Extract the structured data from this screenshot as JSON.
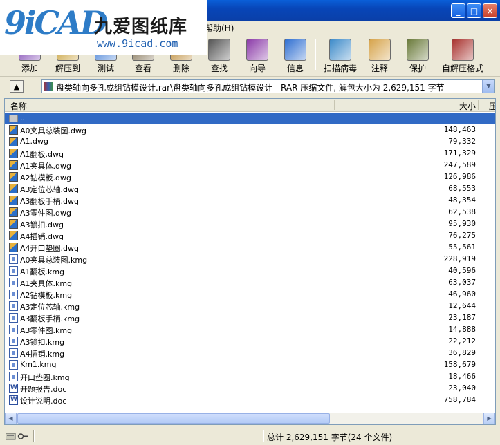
{
  "watermark": {
    "mark": "9iCAD",
    "name_cn": "九爱图纸库",
    "url": "www.9icad.com"
  },
  "menu": {
    "help": "帮助(H)"
  },
  "toolbar": [
    {
      "id": "add",
      "label": "添加",
      "icon": "add-archive-icon",
      "color": "#7a3fb0"
    },
    {
      "id": "extract",
      "label": "解压到",
      "icon": "extract-icon",
      "color": "#c49a2c"
    },
    {
      "id": "test",
      "label": "测试",
      "icon": "test-icon",
      "color": "#3c7ad4"
    },
    {
      "id": "view",
      "label": "查看",
      "icon": "view-icon",
      "color": "#7b6a4a"
    },
    {
      "id": "delete",
      "label": "删除",
      "icon": "delete-icon",
      "color": "#b7832a"
    },
    {
      "id": "find",
      "label": "查找",
      "icon": "find-icon",
      "color": "#555555"
    },
    {
      "id": "wizard",
      "label": "向导",
      "icon": "wizard-icon",
      "color": "#8b3aa8"
    },
    {
      "id": "info",
      "label": "信息",
      "icon": "info-icon",
      "color": "#2f6fd1"
    },
    {
      "id": "virus",
      "label": "扫描病毒",
      "icon": "scan-virus-icon",
      "color": "#3c8ac9"
    },
    {
      "id": "comment",
      "label": "注释",
      "icon": "comment-icon",
      "color": "#d6a34a"
    },
    {
      "id": "protect",
      "label": "保护",
      "icon": "protect-icon",
      "color": "#6a7a3a"
    },
    {
      "id": "sfx",
      "label": "自解压格式",
      "icon": "sfx-icon",
      "color": "#a8322e"
    }
  ],
  "address": {
    "text": "盘类轴向多孔成组钻模设计.rar\\盘类轴向多孔成组钻模设计 - RAR 压缩文件, 解包大小为 2,629,151 字节"
  },
  "columns": {
    "name": "名称",
    "size": "大小",
    "packed": "压"
  },
  "files": [
    {
      "name": "..",
      "size": "",
      "type": "folder"
    },
    {
      "name": "A0夹具总装图.dwg",
      "size": "148,463",
      "type": "dwg"
    },
    {
      "name": "A1.dwg",
      "size": "79,332",
      "type": "dwg"
    },
    {
      "name": "A1翻板.dwg",
      "size": "171,329",
      "type": "dwg"
    },
    {
      "name": "A1夹具体.dwg",
      "size": "247,589",
      "type": "dwg"
    },
    {
      "name": "A2钻模板.dwg",
      "size": "126,986",
      "type": "dwg"
    },
    {
      "name": "A3定位芯轴.dwg",
      "size": "68,553",
      "type": "dwg"
    },
    {
      "name": "A3翻板手柄.dwg",
      "size": "48,354",
      "type": "dwg"
    },
    {
      "name": "A3零件图.dwg",
      "size": "62,538",
      "type": "dwg"
    },
    {
      "name": "A3锁扣.dwg",
      "size": "95,930",
      "type": "dwg"
    },
    {
      "name": "A4插销.dwg",
      "size": "76,275",
      "type": "dwg"
    },
    {
      "name": "A4开口垫圈.dwg",
      "size": "55,561",
      "type": "dwg"
    },
    {
      "name": "A0夹具总装图.kmg",
      "size": "228,919",
      "type": "kmg"
    },
    {
      "name": "A1翻板.kmg",
      "size": "40,596",
      "type": "kmg"
    },
    {
      "name": "A1夹具体.kmg",
      "size": "63,037",
      "type": "kmg"
    },
    {
      "name": "A2钻模板.kmg",
      "size": "46,960",
      "type": "kmg"
    },
    {
      "name": "A3定位芯轴.kmg",
      "size": "12,644",
      "type": "kmg"
    },
    {
      "name": "A3翻板手柄.kmg",
      "size": "23,187",
      "type": "kmg"
    },
    {
      "name": "A3零件图.kmg",
      "size": "14,888",
      "type": "kmg"
    },
    {
      "name": "A3锁扣.kmg",
      "size": "22,212",
      "type": "kmg"
    },
    {
      "name": "A4插销.kmg",
      "size": "36,829",
      "type": "kmg"
    },
    {
      "name": "Km1.kmg",
      "size": "158,679",
      "type": "kmg"
    },
    {
      "name": "开口垫圈.kmg",
      "size": "18,466",
      "type": "kmg"
    },
    {
      "name": "开题报告.doc",
      "size": "23,040",
      "type": "doc"
    },
    {
      "name": "设计说明.doc",
      "size": "758,784",
      "type": "doc"
    }
  ],
  "status": {
    "summary": "总计 2,629,151 字节(24 个文件)"
  }
}
